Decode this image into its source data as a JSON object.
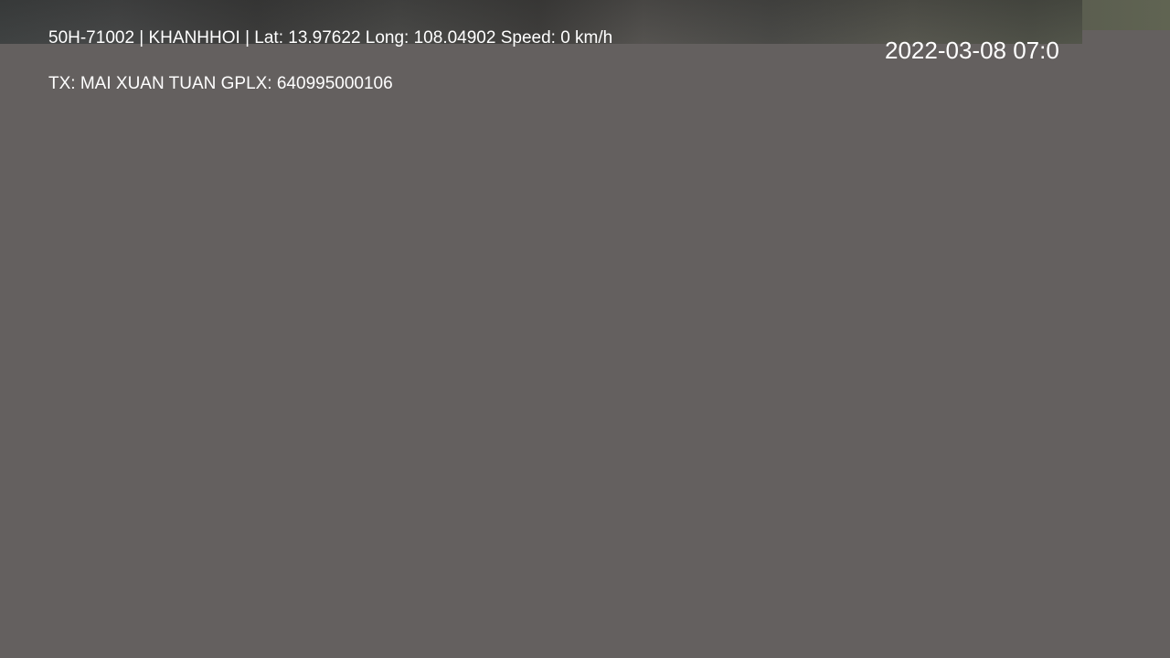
{
  "osd": {
    "vehicle_line": "50H-71002 | KHANHHOI | Lat: 13.97622 Long: 108.04902 Speed: 0 km/h",
    "driver_line": "TX: MAI XUAN TUAN GPLX: 640995000106",
    "clock_partial": "2022-03-08 07:0"
  },
  "colors": {
    "overlay_panel": "#64605f",
    "osd_text": "#ffffff"
  }
}
